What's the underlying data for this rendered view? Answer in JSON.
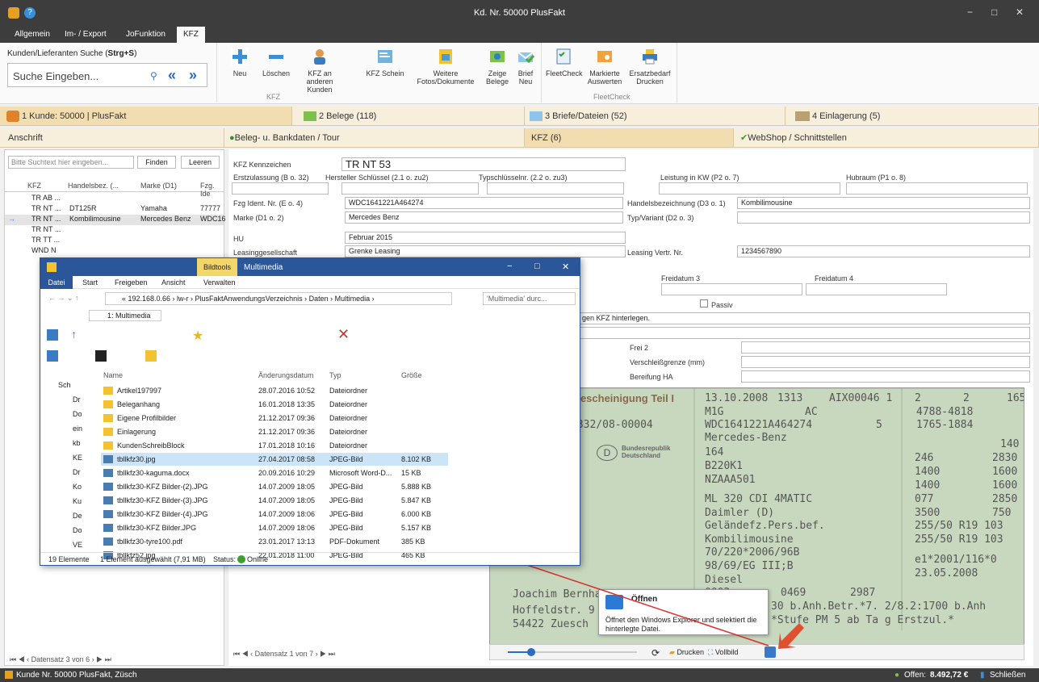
{
  "window": {
    "title": "Kd. Nr. 50000 PlusFakt",
    "controls": [
      "−",
      "□",
      "✕"
    ]
  },
  "menu": [
    "Allgemein",
    "Im- / Export",
    "JoFunktion",
    "KFZ"
  ],
  "search": {
    "title_prefix": "Kunden/Lieferanten Suche (",
    "title_bold": "Strg+S",
    "title_suffix": ")",
    "placeholder": "Suche Eingeben..."
  },
  "ribbon": {
    "kfz": [
      {
        "label": "Neu"
      },
      {
        "label": "Löschen"
      },
      {
        "label": "KFZ an anderen Kunden"
      },
      {
        "label": "KFZ Schein"
      },
      {
        "label": "Weitere Fotos/Dokumente"
      },
      {
        "label": "Zeige Belege"
      },
      {
        "label": "Brief Neu"
      }
    ],
    "fleet": [
      {
        "label": "FleetCheck"
      },
      {
        "label": "Markierte Auswerten"
      },
      {
        "label": "Ersatzbedarf Drucken"
      }
    ],
    "group_kfz": "KFZ",
    "group_fleet": "FleetCheck"
  },
  "main_tabs": [
    "1 Kunde: 50000 | PlusFakt",
    "2 Belege (118)",
    "3 Briefe/Dateien (52)",
    "4 Einlagerung (5)"
  ],
  "sub_tabs": [
    "Anschrift",
    "Beleg- u. Bankdaten / Tour",
    "KFZ (6)",
    "WebShop / Schnittstellen"
  ],
  "left": {
    "search_placeholder": "Bitte Suchtext hier eingeben...",
    "find": "Finden",
    "clear": "Leeren",
    "cols": [
      "KFZ",
      "Handelsbez. (...",
      "Marke (D1)",
      "Fzg. Ide"
    ],
    "rows": [
      [
        "TR AB ...",
        "",
        "",
        ""
      ],
      [
        "TR NT ...",
        "DT125R",
        "Yamaha",
        "77777"
      ],
      [
        "TR NT ...",
        "Kombilimousine",
        "Mercedes Benz",
        "WDC16"
      ],
      [
        "TR NT ...",
        "",
        "",
        ""
      ],
      [
        "TR TT ...",
        "",
        "",
        ""
      ],
      [
        "WND N",
        "",
        "",
        ""
      ]
    ],
    "nav": "Datensatz 3 von 6"
  },
  "form": {
    "kennzeichen_lbl": "KFZ Kennzeichen",
    "kennzeichen": "TR NT 53",
    "erst_lbl": "Erstzulassung (B o. 32)",
    "herst_lbl": "Hersteller Schlüssel (2.1 o. zu2)",
    "typ_lbl": "Typschlüsselnr. (2.2 o. zu3)",
    "leist_lbl": "Leistung in KW (P2 o. 7)",
    "hub_lbl": "Hubraum (P1 o. 8)",
    "fzg_lbl": "Fzg Ident. Nr. (E o. 4)",
    "fzg": "WDC1641221A464274",
    "handel_lbl": "Handelsbezeichnung (D3 o. 1)",
    "handel": "Kombilimousine",
    "marke_lbl": "Marke (D1 o. 2)",
    "marke": "Mercedes Benz",
    "typv_lbl": "Typ/Variant (D2 o. 3)",
    "hu_lbl": "HU",
    "hu": "Februar 2015",
    "leasing_lbl": "Leasinggesellschaft",
    "leasing": "Grenke Leasing",
    "lvn_lbl": "Leasing Vertr. Nr.",
    "lvn": "1234567890",
    "frei3": "Freidatum 3",
    "frei4": "Freidatum 4",
    "passiv": "Passiv",
    "hint": "gen KFZ hinterlegen.",
    "frei2": "Frei 2",
    "verschleiss": "Verschleißgrenze (mm)",
    "bereifung": "Bereifung HA",
    "nav": "Datensatz 1 von 7",
    "print": "Drucken",
    "full": "Vollbild"
  },
  "doc": {
    "lines": [
      "bescheinigung Teil I",
      "13.10.2008",
      "1313",
      "AIX00046 1",
      "M1G",
      "AC",
      "-332/08-00004",
      "WDC1641221A464274",
      "5",
      "Mercedes-Benz",
      "164",
      "B220K1",
      "NZAAA501",
      "ML 320 CDI 4MATIC",
      "Daimler (D)",
      "Geländefz.Pers.bef.",
      "Kombilimousine",
      "70/220*2006/96B",
      "98/69/EG III;B",
      "Diesel",
      "0002",
      "0469",
      "2987",
      "Joachim Bernhard",
      "Hoffeldstr. 9",
      "54422 Zuesch",
      "30 b.Anh.Betr.*7. 2/8.2:1700 b.Anh",
      "*Stufe PM 5 ab Ta g Erstzul.*",
      "2",
      "2",
      "165",
      "4788-4818",
      "1765-1884",
      "140",
      "246",
      "2830",
      "1400",
      "1600",
      "1400",
      "1600",
      "077",
      "2850",
      "3500",
      "750",
      "255/50 R19 103",
      "255/50 R19 103",
      "e1*2001/116*0",
      "23.05.2008",
      "Bundesrepublik Deutschland",
      "D"
    ]
  },
  "explorer": {
    "ribbon_ctx": "Bildtools",
    "ribbon_title": "Multimedia",
    "tabs": [
      "Datei",
      "Start",
      "Freigeben",
      "Ansicht",
      "Verwalten"
    ],
    "address": "« 192.168.0.66 › lw-r › PlusFaktAnwendungsVerzeichnis › Daten › Multimedia ›",
    "search": "'Multimedia' durc...",
    "tab_name": "1: Multimedia",
    "cols": [
      "Name",
      "Änderungsdatum",
      "Typ",
      "Größe"
    ],
    "nav": [
      "Sch",
      "Dr",
      "Do",
      "ein",
      "kb",
      "KE",
      "Dr",
      "Ko",
      "Ku",
      "De",
      "Do",
      "VE"
    ],
    "files": [
      [
        "Artikel197997",
        "28.07.2016 10:52",
        "Dateiordner",
        ""
      ],
      [
        "Beleganhang",
        "16.01.2018 13:35",
        "Dateiordner",
        ""
      ],
      [
        "Eigene Profilbilder",
        "21.12.2017 09:36",
        "Dateiordner",
        ""
      ],
      [
        "Einlagerung",
        "21.12.2017 09:36",
        "Dateiordner",
        ""
      ],
      [
        "KundenSchreibBlock",
        "17.01.2018 10:16",
        "Dateiordner",
        ""
      ],
      [
        "tbllkfz30.jpg",
        "27.04.2017 08:58",
        "JPEG-Bild",
        "8.102 KB"
      ],
      [
        "tbllkfz30-kaguma.docx",
        "20.09.2016 10:29",
        "Microsoft Word-D...",
        "15 KB"
      ],
      [
        "tbllkfz30-KFZ Bilder-(2).JPG",
        "14.07.2009 18:05",
        "JPEG-Bild",
        "5.888 KB"
      ],
      [
        "tbllkfz30-KFZ Bilder-(3).JPG",
        "14.07.2009 18:05",
        "JPEG-Bild",
        "5.847 KB"
      ],
      [
        "tbllkfz30-KFZ Bilder-(4).JPG",
        "14.07.2009 18:06",
        "JPEG-Bild",
        "6.000 KB"
      ],
      [
        "tbllkfz30-KFZ Bilder.JPG",
        "14.07.2009 18:06",
        "JPEG-Bild",
        "5.157 KB"
      ],
      [
        "tbllkfz30-tyre100.pdf",
        "23.01.2017 13:13",
        "PDF-Dokument",
        "385 KB"
      ],
      [
        "tbllkfz52.jpg",
        "22.01.2018 11:00",
        "JPEG-Bild",
        "465 KB"
      ]
    ],
    "status_count": "19 Elemente",
    "status_sel": "1 Element ausgewählt (7,91 MB)",
    "status_lbl": "Status:",
    "status_val": "Online"
  },
  "tooltip": {
    "title": "Öffnen",
    "text": "Öffnet den Windows Explorer und selektiert die hinterlegte Datei."
  },
  "status": {
    "left": "Kunde Nr. 50000 PlusFakt, Züsch",
    "open_lbl": "Offen:",
    "open_val": "8.492,72 €",
    "close": "Schließen"
  }
}
